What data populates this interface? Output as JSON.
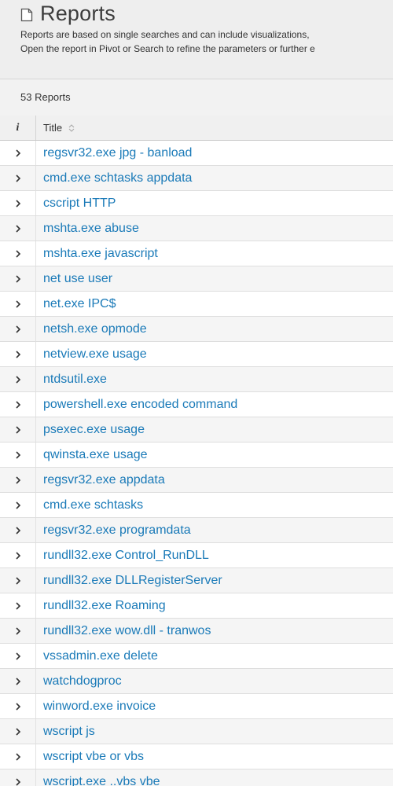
{
  "header": {
    "title": "Reports",
    "description_line1": "Reports are based on single searches and can include visualizations,",
    "description_line2": "Open the report in Pivot or Search to refine the parameters or further e"
  },
  "count_label": "53 Reports",
  "table": {
    "info_header": "i",
    "title_header": "Title",
    "rows": [
      {
        "title": "regsvr32.exe jpg - banload"
      },
      {
        "title": "cmd.exe schtasks appdata"
      },
      {
        "title": "cscript HTTP"
      },
      {
        "title": "mshta.exe abuse"
      },
      {
        "title": "mshta.exe javascript"
      },
      {
        "title": "net use user"
      },
      {
        "title": "net.exe IPC$"
      },
      {
        "title": "netsh.exe opmode"
      },
      {
        "title": "netview.exe usage"
      },
      {
        "title": "ntdsutil.exe"
      },
      {
        "title": "powershell.exe encoded command"
      },
      {
        "title": "psexec.exe usage"
      },
      {
        "title": "qwinsta.exe usage"
      },
      {
        "title": "regsvr32.exe appdata"
      },
      {
        "title": "cmd.exe schtasks"
      },
      {
        "title": "regsvr32.exe programdata"
      },
      {
        "title": "rundll32.exe Control_RunDLL"
      },
      {
        "title": "rundll32.exe DLLRegisterServer"
      },
      {
        "title": "rundll32.exe Roaming"
      },
      {
        "title": "rundll32.exe wow.dll - tranwos"
      },
      {
        "title": "vssadmin.exe delete"
      },
      {
        "title": "watchdogproc"
      },
      {
        "title": "winword.exe invoice"
      },
      {
        "title": "wscript js"
      },
      {
        "title": "wscript vbe or vbs"
      },
      {
        "title": "wscript.exe ..vbs vbe"
      }
    ]
  },
  "icons": {
    "title_icon": "document-icon",
    "sort_icon": "sort-icon",
    "row_expand_icon": "chevron-right-icon"
  },
  "colors": {
    "link": "#1a7ab8",
    "background": "#eeeeee"
  }
}
